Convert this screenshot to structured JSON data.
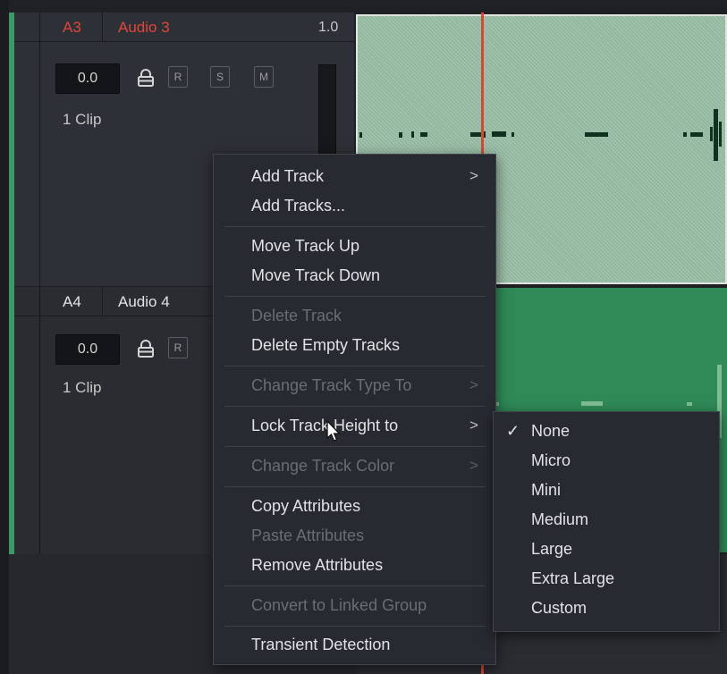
{
  "tracks": {
    "a3": {
      "id": "A3",
      "name": "Audio 3",
      "volume_scale": "1.0",
      "level": "0.0",
      "record": "R",
      "solo": "S",
      "mute": "M",
      "clips": "1 Clip"
    },
    "a4": {
      "id": "A4",
      "name": "Audio 4",
      "level": "0.0",
      "record": "R",
      "clips": "1 Clip"
    }
  },
  "context_menu": {
    "add_track": "Add Track",
    "add_tracks": "Add Tracks...",
    "move_up": "Move Track Up",
    "move_down": "Move Track Down",
    "delete_track": "Delete Track",
    "delete_empty": "Delete Empty Tracks",
    "change_type": "Change Track Type To",
    "lock_height": "Lock Track Height to",
    "change_color": "Change Track Color",
    "copy_attr": "Copy Attributes",
    "paste_attr": "Paste Attributes",
    "remove_attr": "Remove Attributes",
    "convert_linked": "Convert to Linked Group",
    "transient": "Transient Detection",
    "arrow": ">"
  },
  "submenu": {
    "check": "✓",
    "items": [
      "None",
      "Micro",
      "Mini",
      "Medium",
      "Large",
      "Extra Large",
      "Custom"
    ],
    "selected": "None"
  },
  "colors": {
    "track_a3_label": "#e0463a",
    "track_label": "#e2e3e6",
    "clip_a3": "#93b8a0",
    "clip_a4": "#2f8a58",
    "playhead": "#d8463a"
  }
}
